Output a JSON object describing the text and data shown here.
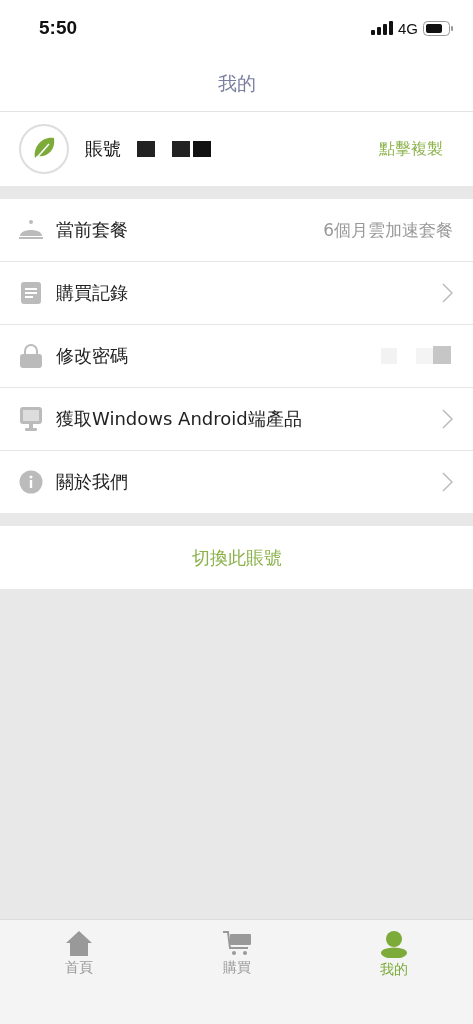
{
  "status_bar": {
    "time": "5:50",
    "network": "4G"
  },
  "header": {
    "title": "我的"
  },
  "account": {
    "label": "賬號",
    "copy_action": "點擊複製"
  },
  "menu": [
    {
      "kind": "value",
      "label": "當前套餐",
      "value": "6個月雲加速套餐"
    },
    {
      "kind": "arrow",
      "label": "購買記錄"
    },
    {
      "kind": "plain",
      "label": "修改密碼"
    },
    {
      "kind": "arrow",
      "label": "獲取Windows Android端產品"
    },
    {
      "kind": "arrow",
      "label": "關於我們"
    }
  ],
  "switch_account": "切換此賬號",
  "tab_bar": [
    {
      "label": "首頁",
      "selected": false
    },
    {
      "label": "購買",
      "selected": false
    },
    {
      "label": "我的",
      "selected": true
    }
  ]
}
